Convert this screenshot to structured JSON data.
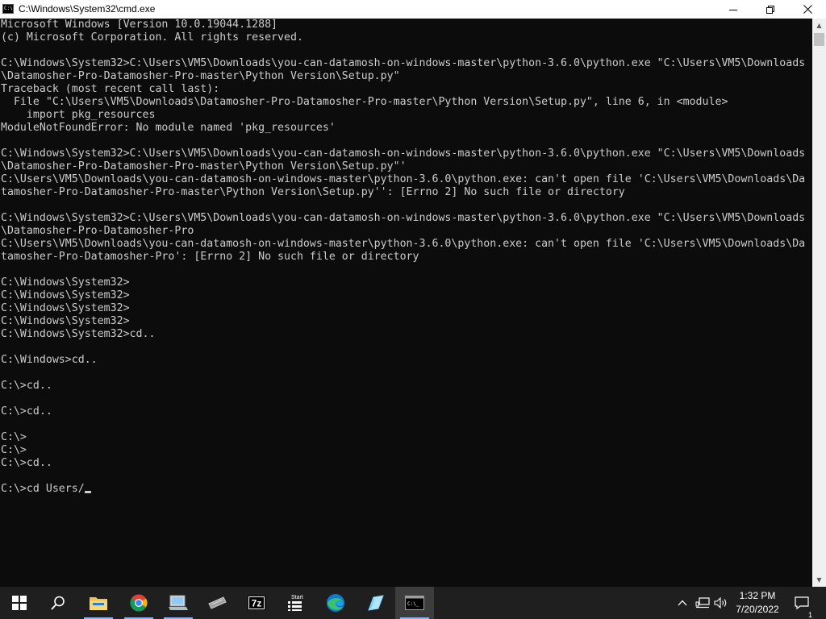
{
  "window": {
    "title": "C:\\Windows\\System32\\cmd.exe",
    "icon_text": "C:\\"
  },
  "console": {
    "lines": [
      "Microsoft Windows [Version 10.0.19044.1288]",
      "(c) Microsoft Corporation. All rights reserved.",
      "",
      "C:\\Windows\\System32>C:\\Users\\VM5\\Downloads\\you-can-datamosh-on-windows-master\\python-3.6.0\\python.exe \"C:\\Users\\VM5\\Downloads",
      "\\Datamosher-Pro-Datamosher-Pro-master\\Python Version\\Setup.py\"",
      "Traceback (most recent call last):",
      "  File \"C:\\Users\\VM5\\Downloads\\Datamosher-Pro-Datamosher-Pro-master\\Python Version\\Setup.py\", line 6, in <module>",
      "    import pkg_resources",
      "ModuleNotFoundError: No module named 'pkg_resources'",
      "",
      "C:\\Windows\\System32>C:\\Users\\VM5\\Downloads\\you-can-datamosh-on-windows-master\\python-3.6.0\\python.exe \"C:\\Users\\VM5\\Downloads",
      "\\Datamosher-Pro-Datamosher-Pro-master\\Python Version\\Setup.py\"'",
      "C:\\Users\\VM5\\Downloads\\you-can-datamosh-on-windows-master\\python-3.6.0\\python.exe: can't open file 'C:\\Users\\VM5\\Downloads\\Da",
      "tamosher-Pro-Datamosher-Pro-master\\Python Version\\Setup.py'': [Errno 2] No such file or directory",
      "",
      "C:\\Windows\\System32>C:\\Users\\VM5\\Downloads\\you-can-datamosh-on-windows-master\\python-3.6.0\\python.exe \"C:\\Users\\VM5\\Downloads",
      "\\Datamosher-Pro-Datamosher-Pro",
      "C:\\Users\\VM5\\Downloads\\you-can-datamosh-on-windows-master\\python-3.6.0\\python.exe: can't open file 'C:\\Users\\VM5\\Downloads\\Da",
      "tamosher-Pro-Datamosher-Pro': [Errno 2] No such file or directory",
      "",
      "C:\\Windows\\System32>",
      "C:\\Windows\\System32>",
      "C:\\Windows\\System32>",
      "C:\\Windows\\System32>",
      "C:\\Windows\\System32>cd..",
      "",
      "C:\\Windows>cd..",
      "",
      "C:\\>cd..",
      "",
      "C:\\>cd..",
      "",
      "C:\\>",
      "C:\\>",
      "C:\\>cd..",
      ""
    ],
    "current_prompt": "C:\\>cd Users/"
  },
  "taskbar": {
    "items": [
      {
        "name": "start-button",
        "icon": "windows-logo-icon"
      },
      {
        "name": "search-button",
        "icon": "search-icon"
      },
      {
        "name": "file-explorer",
        "icon": "folder-icon"
      },
      {
        "name": "chrome",
        "icon": "chrome-icon"
      },
      {
        "name": "computer",
        "icon": "computer-icon"
      },
      {
        "name": "app-keyboard",
        "icon": "keyboard-icon"
      },
      {
        "name": "7zip",
        "icon": "7z-icon",
        "label": "7z"
      },
      {
        "name": "start-menu-app",
        "icon": "start-app-icon",
        "label": "Start"
      },
      {
        "name": "edge",
        "icon": "edge-icon"
      },
      {
        "name": "notepad-app",
        "icon": "pen-icon"
      },
      {
        "name": "cmd",
        "icon": "cmd-icon",
        "active": true
      }
    ],
    "clock": {
      "time": "1:32 PM",
      "date": "7/20/2022"
    },
    "notification_count": "1"
  },
  "colors": {
    "console_bg": "#0c0c0c",
    "console_fg": "#cccccc",
    "taskbar_bg": "#1f1f1f",
    "active_underline": "#8ab4f8"
  }
}
